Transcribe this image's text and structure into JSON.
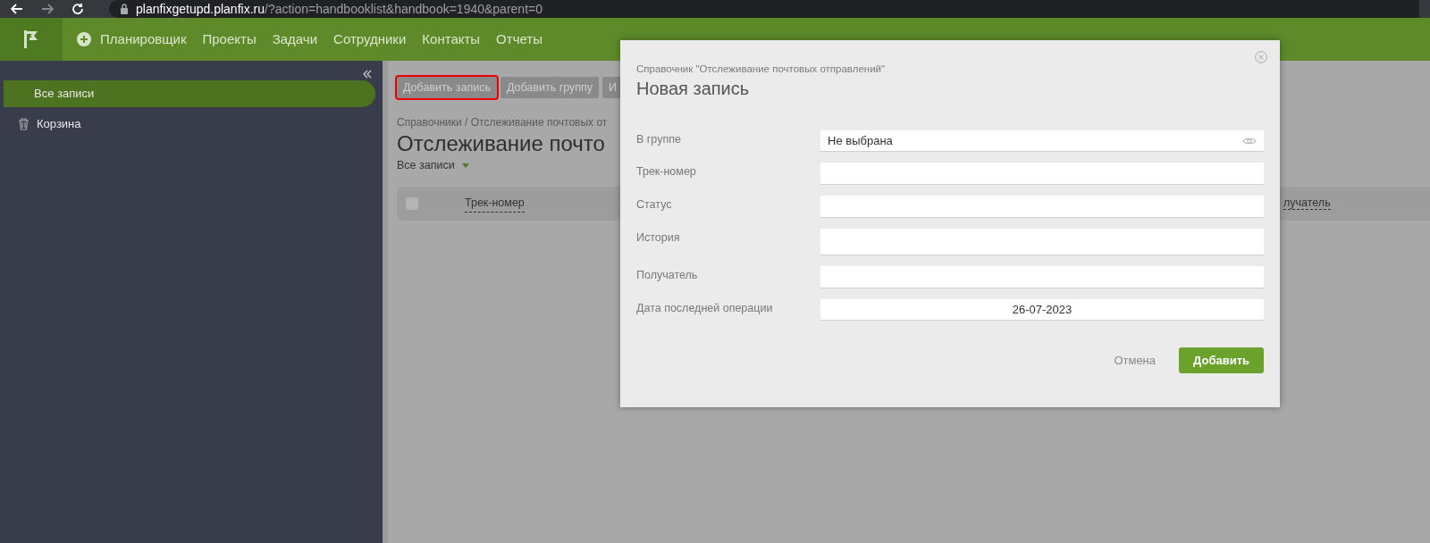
{
  "browser": {
    "host": "planfixgetupd.planfix.ru",
    "path": "/?action=handbooklist&handbook=1940&parent=0"
  },
  "nav": {
    "items": [
      "Планировщик",
      "Проекты",
      "Задачи",
      "Сотрудники",
      "Контакты",
      "Отчеты"
    ]
  },
  "sidebar": {
    "items": [
      {
        "label": "Все записи",
        "selected": true,
        "kind": "plain"
      },
      {
        "label": "Корзина",
        "selected": false,
        "kind": "trash"
      }
    ]
  },
  "toolbar": {
    "buttons": [
      {
        "label": "Добавить запись",
        "highlighted": true
      },
      {
        "label": "Добавить группу",
        "highlighted": false
      },
      {
        "label": "И",
        "highlighted": false
      }
    ]
  },
  "content": {
    "breadcrumb": "Справочники / Отслеживание почтовых от",
    "title": "Отслеживание почто",
    "filter": "Все записи",
    "table": {
      "select_all_checked": false,
      "columns": [
        "Трек-номер",
        "лучатель"
      ]
    }
  },
  "modal": {
    "subtitle": "Справочник \"Отслеживание почтовых отправлений\"",
    "title": "Новая запись",
    "fields": [
      {
        "label": "В группе",
        "kind": "select",
        "value": "Не выбрана"
      },
      {
        "label": "Трек-номер",
        "kind": "text"
      },
      {
        "label": "Статус",
        "kind": "text"
      },
      {
        "label": "История",
        "kind": "textarea"
      },
      {
        "label": "Получатель",
        "kind": "text"
      },
      {
        "label": "Дата последней операции",
        "kind": "date",
        "value": "26-07-2023"
      }
    ],
    "cancel": "Отмена",
    "submit": "Добавить"
  }
}
